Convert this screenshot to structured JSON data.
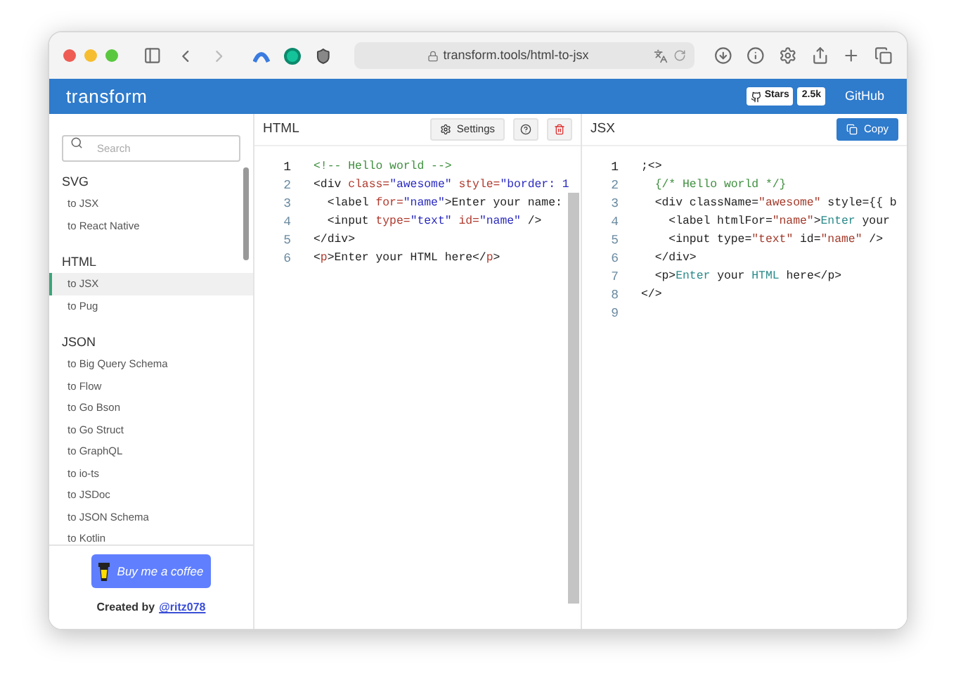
{
  "browser": {
    "url": "transform.tools/html-to-jsx"
  },
  "app_bar": {
    "logo": "transform",
    "stars_label": "Stars",
    "stars_count": "2.5k",
    "link": "GitHub"
  },
  "sidebar": {
    "search": {
      "placeholder": "Search"
    },
    "groups": [
      {
        "title": "SVG",
        "items": [
          {
            "label": "to JSX",
            "selected": false
          },
          {
            "label": "to React Native",
            "selected": false
          }
        ]
      },
      {
        "title": "HTML",
        "items": [
          {
            "label": "to JSX",
            "selected": true
          },
          {
            "label": "to Pug",
            "selected": false
          }
        ]
      },
      {
        "title": "JSON",
        "items": [
          {
            "label": "to Big Query Schema",
            "selected": false
          },
          {
            "label": "to Flow",
            "selected": false
          },
          {
            "label": "to Go Bson",
            "selected": false
          },
          {
            "label": "to Go Struct",
            "selected": false
          },
          {
            "label": "to GraphQL",
            "selected": false
          },
          {
            "label": "to io-ts",
            "selected": false
          },
          {
            "label": "to JSDoc",
            "selected": false
          },
          {
            "label": "to JSON Schema",
            "selected": false
          },
          {
            "label": "to Kotlin",
            "selected": false
          }
        ]
      }
    ],
    "coffee_button": "Buy me a coffee",
    "credit": "Created by",
    "credit_link": "@ritz078"
  },
  "html_panel": {
    "title": "HTML",
    "settings": "Settings",
    "lines": [
      {
        "number": "1",
        "tokens": [
          {
            "text": "<!-- Hello world -->",
            "kind": "comment"
          }
        ]
      },
      {
        "number": "2",
        "tokens": [
          {
            "text": "<div ",
            "kind": "plain"
          },
          {
            "text": "class=",
            "kind": "attr"
          },
          {
            "text": "\"awesome\" ",
            "kind": "string"
          },
          {
            "text": "style=",
            "kind": "attr"
          },
          {
            "text": "\"border: 1",
            "kind": "string"
          }
        ]
      },
      {
        "number": "3",
        "tokens": [
          {
            "text": "  <label ",
            "kind": "plain"
          },
          {
            "text": "for=",
            "kind": "attr"
          },
          {
            "text": "\"name\"",
            "kind": "string"
          },
          {
            "text": ">Enter your name:",
            "kind": "plain"
          }
        ]
      },
      {
        "number": "4",
        "tokens": [
          {
            "text": "  <input ",
            "kind": "plain"
          },
          {
            "text": "type=",
            "kind": "attr"
          },
          {
            "text": "\"text\" ",
            "kind": "string"
          },
          {
            "text": "id=",
            "kind": "attr"
          },
          {
            "text": "\"name\"",
            "kind": "string"
          },
          {
            "text": " />",
            "kind": "plain"
          }
        ]
      },
      {
        "number": "5",
        "tokens": [
          {
            "text": "</div>",
            "kind": "plain"
          }
        ]
      },
      {
        "number": "6",
        "tokens": [
          {
            "text": "<",
            "kind": "plain"
          },
          {
            "text": "p",
            "kind": "attr"
          },
          {
            "text": ">Enter your HTML here</",
            "kind": "plain"
          },
          {
            "text": "p",
            "kind": "attr"
          },
          {
            "text": ">",
            "kind": "plain"
          }
        ]
      }
    ]
  },
  "jsx_panel": {
    "title": "JSX",
    "copy": "Copy",
    "lines": [
      {
        "number": "1",
        "tokens": [
          {
            "text": ";<>",
            "kind": "plain"
          }
        ]
      },
      {
        "number": "2",
        "tokens": [
          {
            "text": "  {/* Hello world */}",
            "kind": "comment"
          }
        ]
      },
      {
        "number": "3",
        "tokens": [
          {
            "text": "  <div className=",
            "kind": "plain"
          },
          {
            "text": "\"awesome\"",
            "kind": "jstring"
          },
          {
            "text": " style={{ b",
            "kind": "plain"
          }
        ]
      },
      {
        "number": "4",
        "tokens": [
          {
            "text": "    <label htmlFor=",
            "kind": "plain"
          },
          {
            "text": "\"name\"",
            "kind": "jstring"
          },
          {
            "text": ">",
            "kind": "plain"
          },
          {
            "text": "Enter",
            "kind": "keyword"
          },
          {
            "text": " your",
            "kind": "plain"
          }
        ]
      },
      {
        "number": "5",
        "tokens": [
          {
            "text": "    <input type=",
            "kind": "plain"
          },
          {
            "text": "\"text\"",
            "kind": "jstring"
          },
          {
            "text": " id=",
            "kind": "plain"
          },
          {
            "text": "\"name\"",
            "kind": "jstring"
          },
          {
            "text": " />",
            "kind": "plain"
          }
        ]
      },
      {
        "number": "6",
        "tokens": [
          {
            "text": "  </div>",
            "kind": "plain"
          }
        ]
      },
      {
        "number": "7",
        "tokens": [
          {
            "text": "  <p>",
            "kind": "plain"
          },
          {
            "text": "Enter",
            "kind": "keyword"
          },
          {
            "text": " your ",
            "kind": "plain"
          },
          {
            "text": "HTML",
            "kind": "keyword"
          },
          {
            "text": " here</p>",
            "kind": "plain"
          }
        ]
      },
      {
        "number": "8",
        "tokens": [
          {
            "text": "</>",
            "kind": "plain"
          }
        ]
      },
      {
        "number": "9"
      }
    ]
  }
}
